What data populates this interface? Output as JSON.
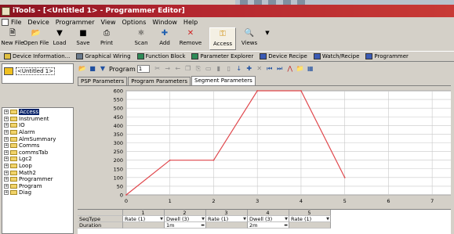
{
  "window": {
    "title": "iTools - [<Untitled 1> - Programmer Editor]"
  },
  "menu": {
    "items": [
      "File",
      "Device",
      "Programmer",
      "View",
      "Options",
      "Window",
      "Help"
    ]
  },
  "toolbar": {
    "buttons": [
      {
        "label": "New File",
        "icon": "new-file-icon"
      },
      {
        "label": "Open File",
        "icon": "open-file-icon"
      },
      {
        "label": "Load",
        "icon": "load-icon"
      },
      {
        "label": "Save",
        "icon": "save-icon"
      },
      {
        "label": "Print",
        "icon": "print-icon"
      },
      {
        "label": "Scan",
        "icon": "scan-icon"
      },
      {
        "label": "Add",
        "icon": "add-icon"
      },
      {
        "label": "Remove",
        "icon": "remove-icon"
      },
      {
        "label": "Access",
        "icon": "access-key-icon"
      },
      {
        "label": "Views",
        "icon": "views-icon"
      }
    ]
  },
  "window_tabs": [
    {
      "label": "Device Information...",
      "icon": "info-icon"
    },
    {
      "label": "Graphical Wiring",
      "icon": "wiring-icon"
    },
    {
      "label": "Function Block",
      "icon": "function-block-icon"
    },
    {
      "label": "Parameter Explorer",
      "icon": "parameter-explorer-icon"
    },
    {
      "label": "Device Recipe",
      "icon": "recipe-icon"
    },
    {
      "label": "Watch/Recipe",
      "icon": "watch-icon"
    },
    {
      "label": "Programmer",
      "icon": "programmer-icon"
    }
  ],
  "device_panel": {
    "device_label": "<Untitled 1>"
  },
  "tree": {
    "items": [
      {
        "label": "Access",
        "selected": true
      },
      {
        "label": "Instrument",
        "selected": false
      },
      {
        "label": "IO",
        "selected": false
      },
      {
        "label": "Alarm",
        "selected": false
      },
      {
        "label": "AlmSummary",
        "selected": false
      },
      {
        "label": "Comms",
        "selected": false
      },
      {
        "label": "commsTab",
        "selected": false
      },
      {
        "label": "Lgc2",
        "selected": false
      },
      {
        "label": "Loop",
        "selected": false
      },
      {
        "label": "Math2",
        "selected": false
      },
      {
        "label": "Programmer",
        "selected": false
      },
      {
        "label": "Program",
        "selected": false
      },
      {
        "label": "Diag",
        "selected": false
      }
    ]
  },
  "program_toolbar": {
    "program_label": "Program",
    "program_value": "1"
  },
  "param_tabs": [
    {
      "label": "PSP Parameters",
      "active": false
    },
    {
      "label": "Program Parameters",
      "active": false
    },
    {
      "label": "Segment Parameters",
      "active": true
    }
  ],
  "chart_data": {
    "type": "line",
    "x": [
      0,
      1,
      2,
      3,
      4,
      5
    ],
    "series": [
      {
        "values": [
          0,
          200,
          200,
          600,
          600,
          100
        ],
        "color": "#e0474c"
      }
    ],
    "xticks": [
      0,
      1,
      2,
      3,
      4,
      5,
      6,
      7
    ],
    "yticks": [
      0,
      50,
      100,
      150,
      200,
      250,
      300,
      350,
      400,
      450,
      500,
      550,
      600
    ],
    "xlim": [
      0,
      7.5
    ],
    "ylim": [
      0,
      600
    ],
    "grid": true,
    "plot_bg": "#ffffff",
    "title": "",
    "xlabel": "",
    "ylabel": ""
  },
  "segment_table": {
    "columns": [
      "1",
      "2",
      "3",
      "4",
      "5"
    ],
    "rows": [
      {
        "name": "SegType",
        "values": [
          "Rate (1)",
          "Dwell (3)",
          "Rate (1)",
          "Dwell (3)",
          "Rate (1)"
        ]
      },
      {
        "name": "Duration",
        "values": [
          "",
          "1m",
          "",
          "2m",
          ""
        ]
      }
    ]
  }
}
